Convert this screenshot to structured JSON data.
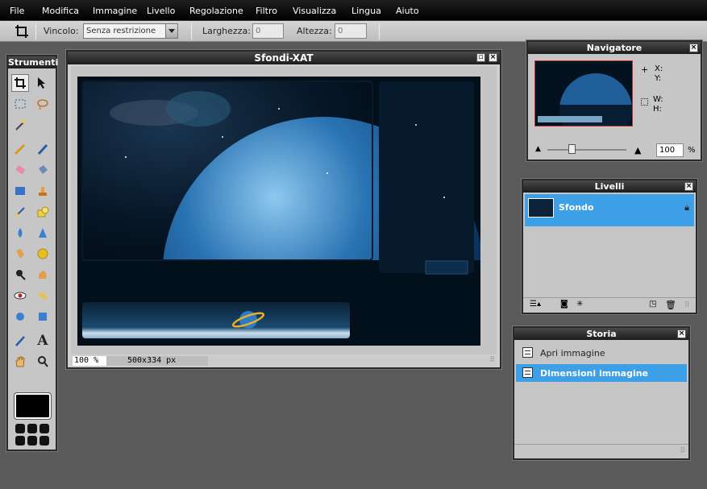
{
  "menu": [
    "File",
    "Modifica",
    "Immagine",
    "Livello",
    "Regolazione",
    "Filtro",
    "Visualizza",
    "Lingua",
    "Aiuto"
  ],
  "options": {
    "constraint_label": "Vincolo:",
    "constraint_value": "Senza restrizione",
    "width_label": "Larghezza:",
    "width_value": "0",
    "height_label": "Altezza:",
    "height_value": "0"
  },
  "tools_panel": {
    "title": "Strumenti"
  },
  "document": {
    "title": "Sfondi-XAT",
    "zoom": "100 %",
    "size": "500x334 px"
  },
  "navigator": {
    "title": "Navigatore",
    "x_label": "X:",
    "y_label": "Y:",
    "w_label": "W:",
    "h_label": "H:",
    "zoom_value": "100",
    "zoom_unit": "%"
  },
  "layers": {
    "title": "Livelli",
    "items": [
      {
        "name": "Sfondo"
      }
    ]
  },
  "history": {
    "title": "Storia",
    "items": [
      {
        "label": "Apri immagine"
      },
      {
        "label": "Dimensioni immagine"
      }
    ]
  },
  "colors": {
    "selection": "#3d9fe6",
    "panel_bg": "#c6c6c6",
    "workspace": "#5a5a5a"
  }
}
